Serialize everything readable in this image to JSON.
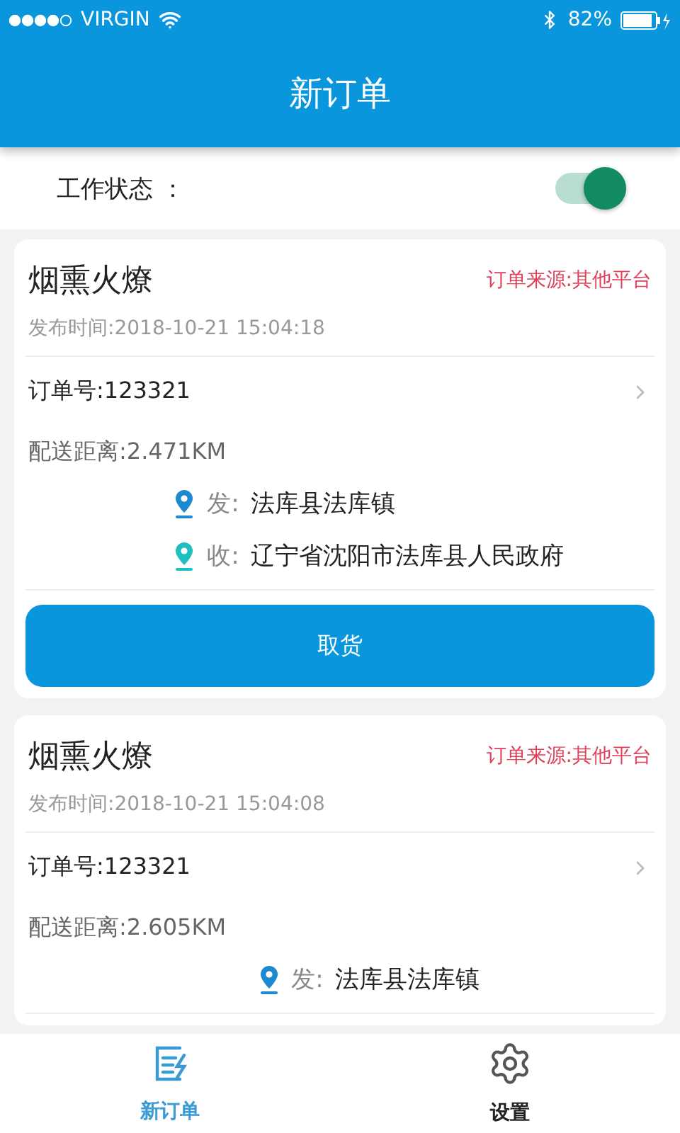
{
  "status_bar": {
    "carrier": "VIRGIN",
    "battery": "82%"
  },
  "header": {
    "title": "新订单"
  },
  "work_status": {
    "label": "工作状态 ：",
    "on": true
  },
  "orders": [
    {
      "title": "烟熏火燎",
      "source": "订单来源:其他平台",
      "time": "发布时间:2018-10-21 15:04:18",
      "order_no": "订单号:123321",
      "distance": "配送距离:2.471KM",
      "from_label": "发:",
      "from": "法库县法库镇",
      "to_label": "收:",
      "to": "辽宁省沈阳市法库县人民政府",
      "button": "取货"
    },
    {
      "title": "烟熏火燎",
      "source": "订单来源:其他平台",
      "time": "发布时间:2018-10-21 15:04:08",
      "order_no": "订单号:123321",
      "distance": "配送距离:2.605KM",
      "from_label": "发:",
      "from": "法库县法库镇"
    }
  ],
  "tabs": [
    {
      "label": "新订单",
      "kind": "edit",
      "selected": true
    },
    {
      "label": "设置",
      "kind": "gear",
      "selected": false
    }
  ]
}
